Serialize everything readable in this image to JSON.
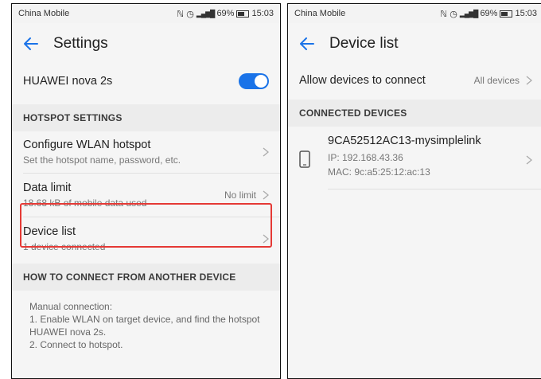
{
  "left_screen": {
    "status": {
      "carrier": "China Mobile",
      "battery": "69%",
      "time": "15:03"
    },
    "title": "Settings",
    "device_name": "HUAWEI nova 2s",
    "hotspot_enabled": true,
    "hotspot_section": "HOTSPOT SETTINGS",
    "configure": {
      "title": "Configure WLAN hotspot",
      "subtitle": "Set the hotspot name, password, etc."
    },
    "data_limit": {
      "title": "Data limit",
      "subtitle": "18.68 kB of mobile data used",
      "value": "No limit"
    },
    "device_list": {
      "title": "Device list",
      "subtitle": "1 device connected"
    },
    "connect_section": "HOW TO CONNECT FROM ANOTHER DEVICE",
    "instructions": {
      "line1": "Manual connection:",
      "line2": "1. Enable WLAN on target device, and find the hotspot",
      "line3": "HUAWEI nova 2s.",
      "line4": "2. Connect to hotspot."
    }
  },
  "right_screen": {
    "status": {
      "carrier": "China Mobile",
      "battery": "69%",
      "time": "15:03"
    },
    "title": "Device list",
    "allow": {
      "label": "Allow devices to connect",
      "value": "All devices"
    },
    "connected_section": "CONNECTED DEVICES",
    "device": {
      "name": "9CA52512AC13-mysimplelink",
      "ip": "IP: 192.168.43.36",
      "mac": "MAC: 9c:a5:25:12:ac:13"
    }
  },
  "colors": {
    "accent": "#1a73e8",
    "highlight": "#e53935"
  }
}
